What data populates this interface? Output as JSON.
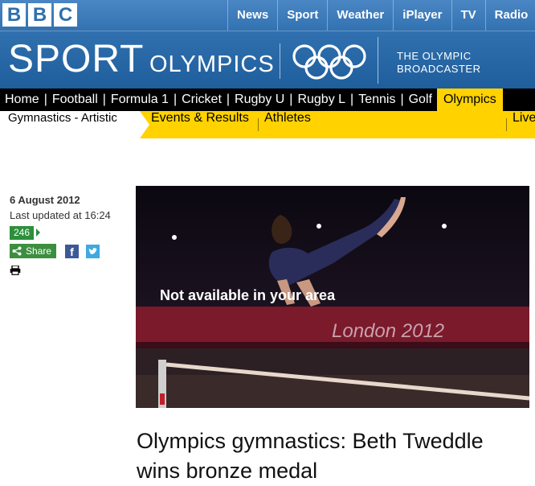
{
  "brand": {
    "bbc_letters": [
      "B",
      "B",
      "C"
    ]
  },
  "global_nav": [
    "News",
    "Sport",
    "Weather",
    "iPlayer",
    "TV",
    "Radio"
  ],
  "masthead": {
    "sport": "SPORT",
    "olympics": "OLYMPICS",
    "broadcaster_line1": "THE OLYMPIC",
    "broadcaster_line2": "BROADCASTER"
  },
  "sports_nav": [
    "Home",
    "Football",
    "Formula 1",
    "Cricket",
    "Rugby U",
    "Rugby L",
    "Tennis",
    "Golf",
    "Olympics"
  ],
  "sub_nav": {
    "current": "Gymnastics - Artistic",
    "links": [
      "Events & Results",
      "Athletes",
      "Live"
    ]
  },
  "story": {
    "date": "6 August 2012",
    "updated": "Last updated at 16:24",
    "share_count": "246",
    "share_label": "Share",
    "facebook_glyph": "f",
    "media_message": "Not available in your area",
    "media_banner_text": "London 2012",
    "headline": "Olympics gymnastics: Beth Tweddle wins bronze medal"
  },
  "icons": [
    "share-icon",
    "facebook-icon",
    "twitter-icon",
    "print-icon",
    "olympic-rings-icon"
  ],
  "colors": {
    "header_blue": "#2f6fae",
    "nav_black": "#000000",
    "accent_yellow": "#ffd200",
    "share_green": "#3b8f3f"
  }
}
